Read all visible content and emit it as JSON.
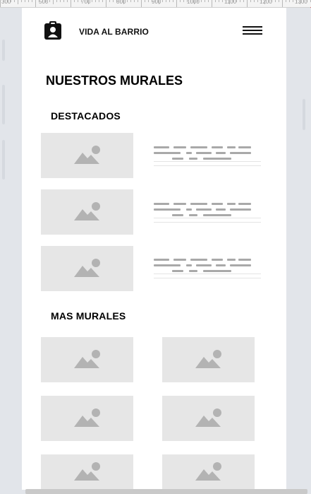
{
  "header": {
    "brand": "VIDA AL BARRIO",
    "logo_icon": "clipboard-user-icon",
    "menu_icon": "hamburger-menu-icon"
  },
  "page": {
    "title": "NUESTROS MURALES"
  },
  "sections": {
    "featured": {
      "title": "DESTACADOS",
      "item_count": 3
    },
    "more": {
      "title": "MAS MURALES",
      "item_count": 6
    }
  },
  "ruler": {
    "labels": [
      "300",
      "500",
      "700",
      "800",
      "900",
      "1000",
      "1100",
      "1200",
      "1300"
    ]
  },
  "placeholder_icon": "image-placeholder-icon",
  "colors": {
    "placeholder_bg": "#e6e6e6",
    "placeholder_icon": "#b3b3b3",
    "text_lines": "#a9a9a9",
    "canvas_bg": "#ffffff",
    "workspace_bg": "#e2e5ea"
  }
}
